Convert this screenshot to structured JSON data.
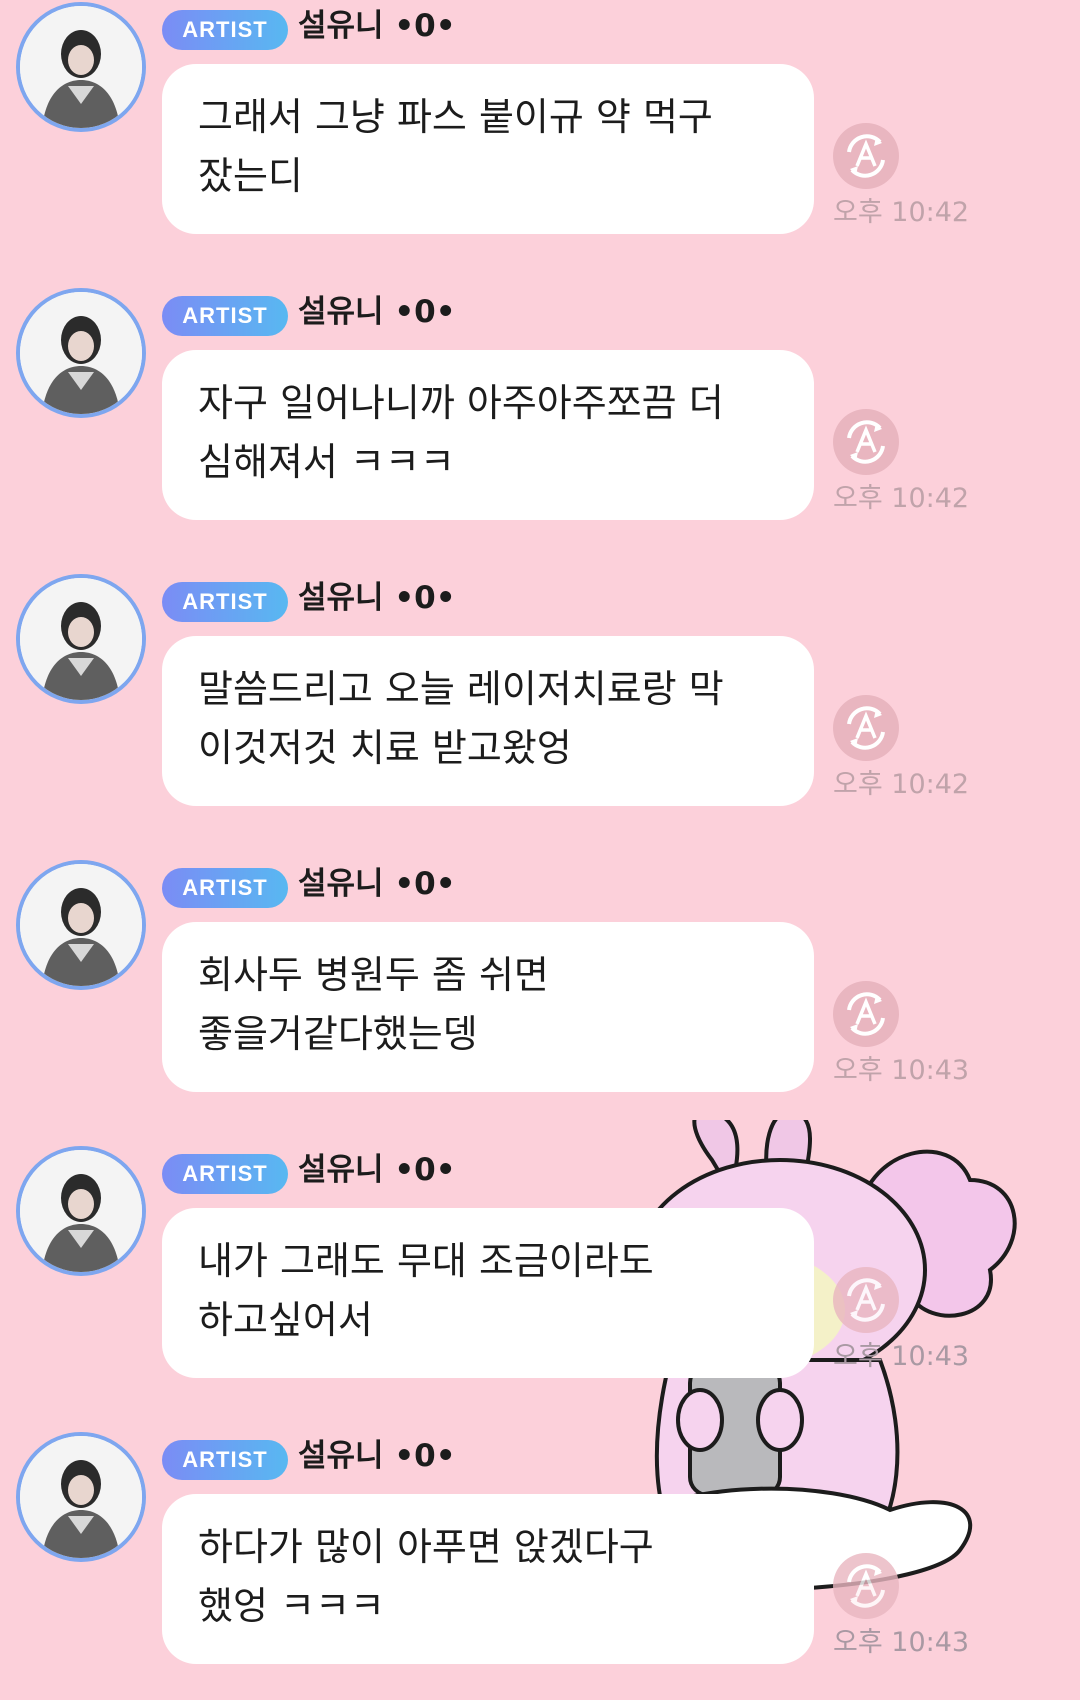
{
  "colors": {
    "background": "#fcd0da",
    "bubble": "#ffffff",
    "badge_gradient": [
      "#7b8cf5",
      "#58b8f1"
    ],
    "avatar_ring": "#7ea6ef",
    "timestamp": "#c0a3aa"
  },
  "messages": [
    {
      "badge": "ARTIST",
      "sender": "설유니 •0•",
      "text": "그래서 그냥 파스 붙이규 약 먹구\n잤는디",
      "time": "오후 10:42",
      "translate_icon": "auto-translate-icon",
      "avatar_icon": "profile-photo"
    },
    {
      "badge": "ARTIST",
      "sender": "설유니 •0•",
      "text": "자구 일어나니까 아주아주쪼끔 더\n심해져서 ㅋㅋㅋ",
      "time": "오후 10:42",
      "translate_icon": "auto-translate-icon",
      "avatar_icon": "profile-photo"
    },
    {
      "badge": "ARTIST",
      "sender": "설유니 •0•",
      "text": "말씀드리고 오늘 레이저치료랑 막\n이것저것 치료 받고왔엉",
      "time": "오후 10:42",
      "translate_icon": "auto-translate-icon",
      "avatar_icon": "profile-photo"
    },
    {
      "badge": "ARTIST",
      "sender": "설유니 •0•",
      "text": "회사두 병원두 좀 쉬면\n좋을거같다했는뎅",
      "time": "오후 10:43",
      "translate_icon": "auto-translate-icon",
      "avatar_icon": "profile-photo"
    },
    {
      "badge": "ARTIST",
      "sender": "설유니 •0•",
      "text": "내가 그래도 무대 조금이라도\n하고싶어서",
      "time": "오후 10:43",
      "translate_icon": "auto-translate-icon",
      "avatar_icon": "profile-photo"
    },
    {
      "badge": "ARTIST",
      "sender": "설유니 •0•",
      "text": "하다가 많이 아푸면 앉겠다구\n했엉 ㅋㅋㅋ",
      "time": "오후 10:43",
      "translate_icon": "auto-translate-icon",
      "avatar_icon": "profile-photo"
    }
  ],
  "background_sticker": "bunny-holding-phone-sticker"
}
